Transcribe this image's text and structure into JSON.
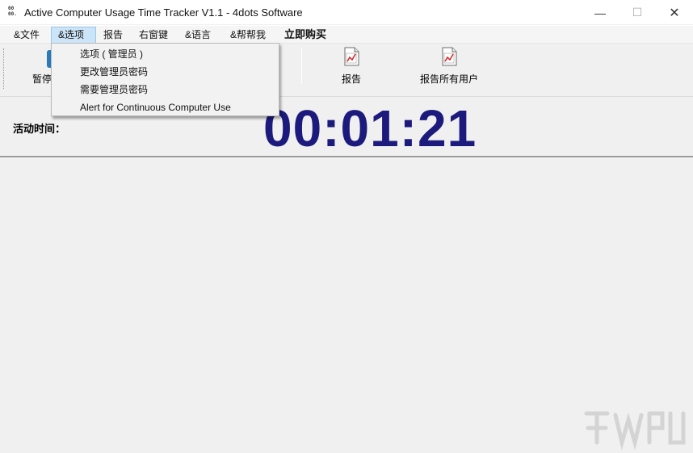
{
  "window": {
    "title": "Active Computer Usage Time Tracker V1.1 - 4dots Software",
    "icon": "app-icon",
    "icon_text": "00\n00.",
    "minimize": "—",
    "maximize": "☐",
    "close": "✕"
  },
  "menu": {
    "items": [
      {
        "label": "&文件"
      },
      {
        "label": "&选项"
      },
      {
        "label": "报告"
      },
      {
        "label": "右窗键"
      },
      {
        "label": "&语言"
      },
      {
        "label": "&帮帮我"
      },
      {
        "label": "立即购买"
      }
    ]
  },
  "dropdown": {
    "items": [
      {
        "label": "选项 ( 管理员 )"
      },
      {
        "label": "更改管理员密码"
      },
      {
        "label": "需要管理员密码"
      },
      {
        "label": "Alert for Continuous Computer Use"
      }
    ]
  },
  "toolbar": {
    "pause_label": "暂停",
    "report_label": "报告",
    "report_all_label": "报告所有用户"
  },
  "status": {
    "active_time_label": "活动时间：",
    "timer": "00:01:21"
  },
  "colors": {
    "timer": "#1c1a7c",
    "menu_highlight": "#cce4f7",
    "background": "#f0f0f0"
  }
}
